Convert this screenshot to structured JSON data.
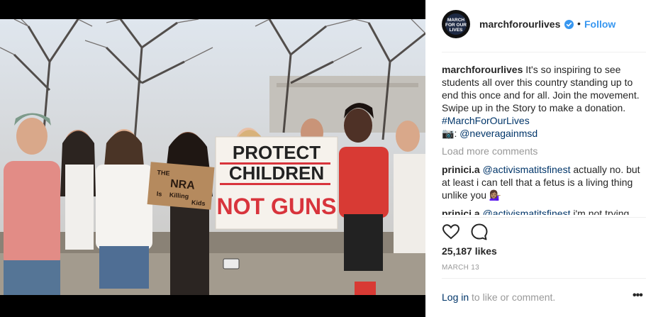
{
  "post": {
    "username": "marchforourlives",
    "follow_label": "Follow",
    "dot": "•",
    "avatar_text": "MARCH FOR OUR LIVES",
    "caption": {
      "author": "marchforourlives",
      "text": "It's so inspiring to see students all over this country standing up to end this once and for all. Join the movement. Swipe up in the Story to make a donation.",
      "hashtag": "#MarchForOurLives",
      "camera_emoji": "📷",
      "mention_prefix": ":",
      "mention": "@neveragainmsd"
    },
    "load_more": "Load more comments",
    "comments": [
      {
        "author": "prinici.a",
        "mention": "@activismatitsfinest",
        "text": "actually no. but at least i can tell that a fetus is a living thing unlike you 💁🏽‍♀️"
      },
      {
        "author": "prinici.a",
        "mention": "@activismatitsfinest",
        "text": "i'm not trying"
      }
    ],
    "likes": "25,187 likes",
    "date": "MARCH 13",
    "login_link": "Log in",
    "login_rest": " to like or comment.",
    "more_label": "•••"
  },
  "photo": {
    "sign_main": [
      "PROTECT",
      "CHILDREN",
      "NOT GUNS"
    ],
    "sign_small": [
      "THE",
      "NRA",
      "Is",
      "Killing",
      "Kids"
    ]
  },
  "colors": {
    "link": "#3897f0",
    "hashtag": "#003569",
    "text": "#262626",
    "muted": "#999999",
    "sign_red": "#d8343c"
  }
}
